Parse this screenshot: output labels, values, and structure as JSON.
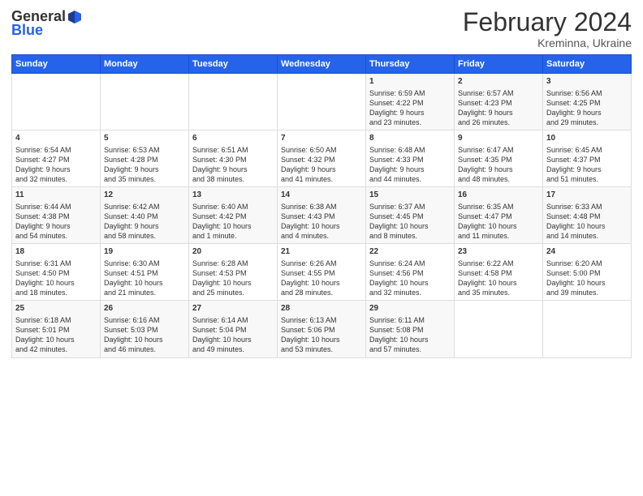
{
  "logo": {
    "general": "General",
    "blue": "Blue"
  },
  "title": "February 2024",
  "subtitle": "Kreminna, Ukraine",
  "days_of_week": [
    "Sunday",
    "Monday",
    "Tuesday",
    "Wednesday",
    "Thursday",
    "Friday",
    "Saturday"
  ],
  "weeks": [
    [
      {
        "day": "",
        "content": ""
      },
      {
        "day": "",
        "content": ""
      },
      {
        "day": "",
        "content": ""
      },
      {
        "day": "",
        "content": ""
      },
      {
        "day": "1",
        "content": "Sunrise: 6:59 AM\nSunset: 4:22 PM\nDaylight: 9 hours\nand 23 minutes."
      },
      {
        "day": "2",
        "content": "Sunrise: 6:57 AM\nSunset: 4:23 PM\nDaylight: 9 hours\nand 26 minutes."
      },
      {
        "day": "3",
        "content": "Sunrise: 6:56 AM\nSunset: 4:25 PM\nDaylight: 9 hours\nand 29 minutes."
      }
    ],
    [
      {
        "day": "4",
        "content": "Sunrise: 6:54 AM\nSunset: 4:27 PM\nDaylight: 9 hours\nand 32 minutes."
      },
      {
        "day": "5",
        "content": "Sunrise: 6:53 AM\nSunset: 4:28 PM\nDaylight: 9 hours\nand 35 minutes."
      },
      {
        "day": "6",
        "content": "Sunrise: 6:51 AM\nSunset: 4:30 PM\nDaylight: 9 hours\nand 38 minutes."
      },
      {
        "day": "7",
        "content": "Sunrise: 6:50 AM\nSunset: 4:32 PM\nDaylight: 9 hours\nand 41 minutes."
      },
      {
        "day": "8",
        "content": "Sunrise: 6:48 AM\nSunset: 4:33 PM\nDaylight: 9 hours\nand 44 minutes."
      },
      {
        "day": "9",
        "content": "Sunrise: 6:47 AM\nSunset: 4:35 PM\nDaylight: 9 hours\nand 48 minutes."
      },
      {
        "day": "10",
        "content": "Sunrise: 6:45 AM\nSunset: 4:37 PM\nDaylight: 9 hours\nand 51 minutes."
      }
    ],
    [
      {
        "day": "11",
        "content": "Sunrise: 6:44 AM\nSunset: 4:38 PM\nDaylight: 9 hours\nand 54 minutes."
      },
      {
        "day": "12",
        "content": "Sunrise: 6:42 AM\nSunset: 4:40 PM\nDaylight: 9 hours\nand 58 minutes."
      },
      {
        "day": "13",
        "content": "Sunrise: 6:40 AM\nSunset: 4:42 PM\nDaylight: 10 hours\nand 1 minute."
      },
      {
        "day": "14",
        "content": "Sunrise: 6:38 AM\nSunset: 4:43 PM\nDaylight: 10 hours\nand 4 minutes."
      },
      {
        "day": "15",
        "content": "Sunrise: 6:37 AM\nSunset: 4:45 PM\nDaylight: 10 hours\nand 8 minutes."
      },
      {
        "day": "16",
        "content": "Sunrise: 6:35 AM\nSunset: 4:47 PM\nDaylight: 10 hours\nand 11 minutes."
      },
      {
        "day": "17",
        "content": "Sunrise: 6:33 AM\nSunset: 4:48 PM\nDaylight: 10 hours\nand 14 minutes."
      }
    ],
    [
      {
        "day": "18",
        "content": "Sunrise: 6:31 AM\nSunset: 4:50 PM\nDaylight: 10 hours\nand 18 minutes."
      },
      {
        "day": "19",
        "content": "Sunrise: 6:30 AM\nSunset: 4:51 PM\nDaylight: 10 hours\nand 21 minutes."
      },
      {
        "day": "20",
        "content": "Sunrise: 6:28 AM\nSunset: 4:53 PM\nDaylight: 10 hours\nand 25 minutes."
      },
      {
        "day": "21",
        "content": "Sunrise: 6:26 AM\nSunset: 4:55 PM\nDaylight: 10 hours\nand 28 minutes."
      },
      {
        "day": "22",
        "content": "Sunrise: 6:24 AM\nSunset: 4:56 PM\nDaylight: 10 hours\nand 32 minutes."
      },
      {
        "day": "23",
        "content": "Sunrise: 6:22 AM\nSunset: 4:58 PM\nDaylight: 10 hours\nand 35 minutes."
      },
      {
        "day": "24",
        "content": "Sunrise: 6:20 AM\nSunset: 5:00 PM\nDaylight: 10 hours\nand 39 minutes."
      }
    ],
    [
      {
        "day": "25",
        "content": "Sunrise: 6:18 AM\nSunset: 5:01 PM\nDaylight: 10 hours\nand 42 minutes."
      },
      {
        "day": "26",
        "content": "Sunrise: 6:16 AM\nSunset: 5:03 PM\nDaylight: 10 hours\nand 46 minutes."
      },
      {
        "day": "27",
        "content": "Sunrise: 6:14 AM\nSunset: 5:04 PM\nDaylight: 10 hours\nand 49 minutes."
      },
      {
        "day": "28",
        "content": "Sunrise: 6:13 AM\nSunset: 5:06 PM\nDaylight: 10 hours\nand 53 minutes."
      },
      {
        "day": "29",
        "content": "Sunrise: 6:11 AM\nSunset: 5:08 PM\nDaylight: 10 hours\nand 57 minutes."
      },
      {
        "day": "",
        "content": ""
      },
      {
        "day": "",
        "content": ""
      }
    ]
  ]
}
